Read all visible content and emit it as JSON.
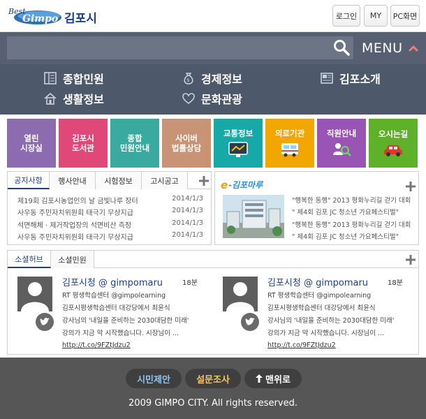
{
  "header": {
    "logo_text": "Best Gimpo",
    "site_name": "김포시",
    "login_label": "로그인",
    "my_label": "MY",
    "pc_label": "PC화면"
  },
  "search": {
    "placeholder": "",
    "menu_label": "MENU"
  },
  "categories": [
    {
      "label": "종합민원",
      "icon": "document-icon"
    },
    {
      "label": "경제정보",
      "icon": "money-bag-icon"
    },
    {
      "label": "김포소개",
      "icon": "book-icon"
    },
    {
      "label": "생활정보",
      "icon": "house-icon"
    },
    {
      "label": "문화관광",
      "icon": "heart-icon"
    }
  ],
  "tiles": [
    {
      "label": "열린\n시장실",
      "color": "#8c6bb1"
    },
    {
      "label": "김포시\n도서관",
      "color": "#e1487a"
    },
    {
      "label": "종합\n민원안내",
      "color": "#3aaaa0"
    },
    {
      "label": "사이버\n법률상담",
      "color": "#c99476"
    },
    {
      "label": "교통정보",
      "color": "#17a9a7"
    },
    {
      "label": "의료기관",
      "color": "#f2a700"
    },
    {
      "label": "직원안내",
      "color": "#9a55b4"
    },
    {
      "label": "오시는길",
      "color": "#5fb12a"
    }
  ],
  "notice": {
    "tabs": [
      "공지사항",
      "행사안내",
      "시험정보",
      "고시공고"
    ],
    "items": [
      {
        "title": "제19회 김포시농업인의 날 금빛나루 장터",
        "date": "2014/1/3"
      },
      {
        "title": "사우동 주민자치위원회 태극기 무상지급",
        "date": "2014/1/3"
      },
      {
        "title": "석면해체 · 제거작업장의 석면비산 측정",
        "date": "2014/1/3"
      },
      {
        "title": "사우동 주민자치위원회 태극기 무상지급",
        "date": "2014/1/3"
      }
    ]
  },
  "news": {
    "brand": "e-김포마루",
    "items": [
      "\"행복한 동행\" 2013 평화누리길 걷기 대회",
      "\" 제4회 김포 JC 청소년 가요페스티벌\"",
      "\"행복한 동행\" 2013 평화누리길 걷기 대회",
      "\" 제4회 김포 JC 청소년 가요페스티벌\""
    ]
  },
  "social": {
    "tabs": [
      "소셜허브",
      "소셜민원"
    ],
    "posts": [
      {
        "name": "김포시청 @ gimpomaru",
        "time": "18분",
        "lines": [
          "RT 평생학습센터 @gimpolearning",
          "김포시평생학습센터 대강당에서 최윤식",
          "강사님의 '내일을 준비하는 2030대담한 미래'",
          "강의가 지금 막 시작했습니다. 시장님이 ..."
        ],
        "link": "http://t.co/9FZtJdzu2"
      },
      {
        "name": "김포시청 @ gimpomaru",
        "time": "18분",
        "lines": [
          "RT 평생학습센터 @gimpolearning",
          "김포시평생학습센터 대강당에서 최윤식",
          "강사님의 '내일을 준비하는 2030대담한 미래'",
          "강의가 지금 막 시작했습니다. 시장님이 ..."
        ],
        "link": "http://t.co/9FZtJdzu2"
      }
    ]
  },
  "footer": {
    "proposal_label": "시민제안",
    "survey_label": "설문조사",
    "top_label": "맨위로",
    "copyright": "2009 GIMPO CITY. All rights reserved.",
    "proposal_color": "#8fc3ec",
    "survey_color": "#f3c36a"
  }
}
